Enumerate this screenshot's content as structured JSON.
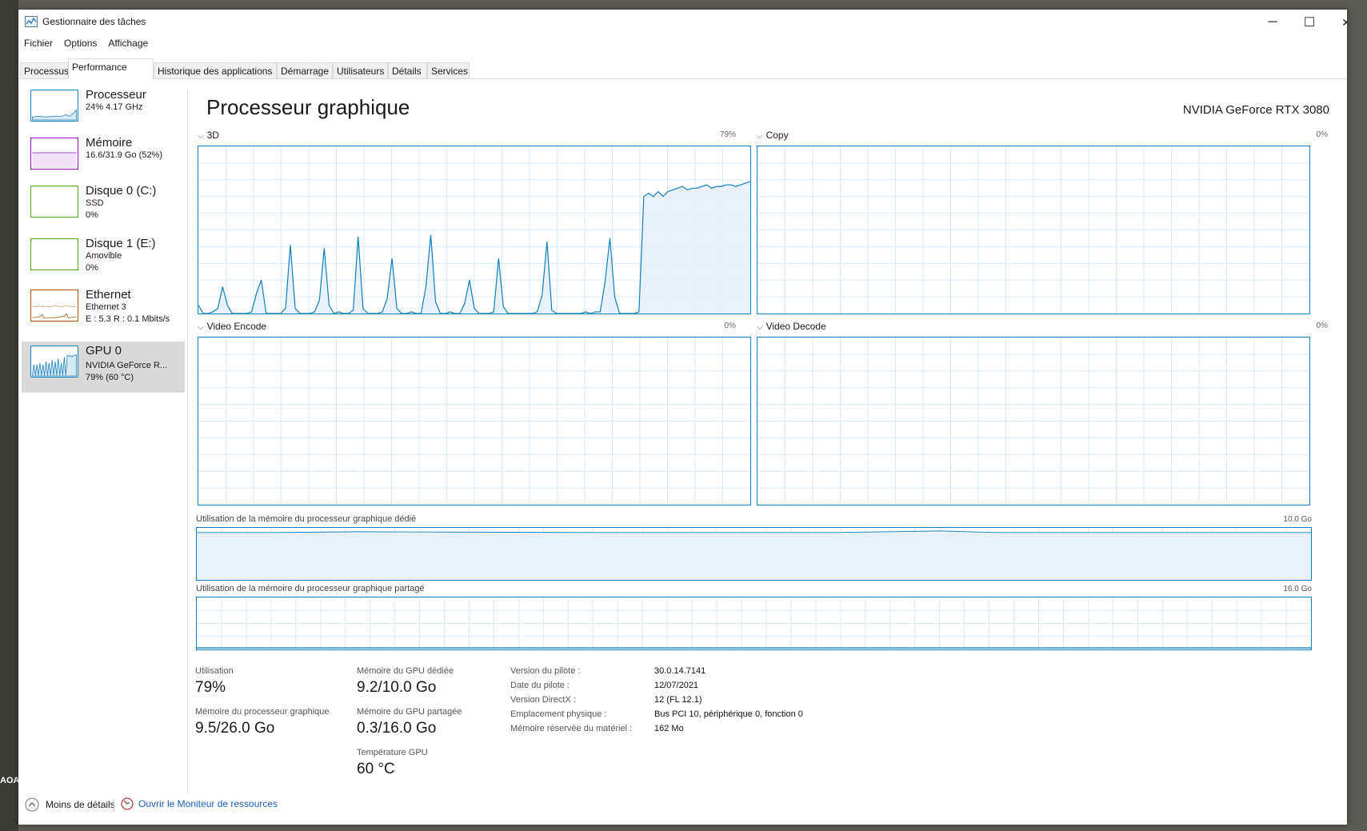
{
  "window": {
    "title": "Gestionnaire des tâches",
    "minimize": "─",
    "maximize": "☐",
    "close": "✕"
  },
  "menu": [
    "Fichier",
    "Options",
    "Affichage"
  ],
  "tabs": [
    "Processus",
    "Performance",
    "Historique des applications",
    "Démarrage",
    "Utilisateurs",
    "Détails",
    "Services"
  ],
  "active_tab": "Performance",
  "sidebar": [
    {
      "name": "Processeur",
      "sub1": "24%  4.17 GHz",
      "sub2": "",
      "color": "#117dbb"
    },
    {
      "name": "Mémoire",
      "sub1": "16.6/31.9 Go (52%)",
      "sub2": "",
      "color": "#8b12ae"
    },
    {
      "name": "Disque 0 (C:)",
      "sub1": "SSD",
      "sub2": "0%",
      "color": "#4da60c"
    },
    {
      "name": "Disque 1 (E:)",
      "sub1": "Amovible",
      "sub2": "0%",
      "color": "#4da60c"
    },
    {
      "name": "Ethernet",
      "sub1": "Ethernet 3",
      "sub2": "E : 5.3  R : 0.1 Mbits/s",
      "color": "#a74f01"
    },
    {
      "name": "GPU 0",
      "sub1": "NVIDIA GeForce R...",
      "sub2": "79%  (60 °C)",
      "color": "#117dbb"
    }
  ],
  "main": {
    "title": "Processeur graphique",
    "gpu_model": "NVIDIA GeForce RTX 3080",
    "engines": [
      {
        "label": "3D",
        "pct": "79%"
      },
      {
        "label": "Copy",
        "pct": "0%"
      },
      {
        "label": "Video Encode",
        "pct": "0%"
      },
      {
        "label": "Video Decode",
        "pct": "0%"
      }
    ],
    "dedicated_label": "Utilisation de la mémoire du processeur graphique dédié",
    "dedicated_max": "10.0 Go",
    "shared_label": "Utilisation de la mémoire du processeur graphique partagé",
    "shared_max": "16.0 Go"
  },
  "stats": {
    "util_label": "Utilisation",
    "util_value": "79%",
    "gpumem_label": "Mémoire du processeur graphique",
    "gpumem_value": "9.5/26.0 Go",
    "dedicated_label": "Mémoire du GPU dédiée",
    "dedicated_value": "9.2/10.0 Go",
    "shared_label": "Mémoire du GPU partagée",
    "shared_value": "0.3/16.0 Go",
    "temp_label": "Température GPU",
    "temp_value": "60 °C"
  },
  "properties": [
    {
      "label": "Version du pilote :",
      "value": "30.0.14.7141"
    },
    {
      "label": "Date du pilote :",
      "value": "12/07/2021"
    },
    {
      "label": "Version DirectX :",
      "value": "12 (FL 12.1)"
    },
    {
      "label": "Emplacement physique :",
      "value": "Bus PCI 10, périphérique 0, fonction 0"
    },
    {
      "label": "Mémoire réservée du matériel :",
      "value": "162 Mo"
    }
  ],
  "footer": {
    "less_details": "Moins de détails",
    "resource_monitor": "Ouvrir le Moniteur de ressources"
  },
  "chart_data": {
    "type": "area",
    "title": "3D",
    "ylim": [
      0,
      100
    ],
    "grid": true,
    "series": [
      {
        "name": "3D",
        "values": [
          5,
          0,
          0,
          1,
          3,
          16,
          5,
          0,
          0,
          0,
          0,
          1,
          12,
          20,
          0,
          0,
          0,
          0,
          3,
          41,
          3,
          0,
          0,
          0,
          1,
          8,
          39,
          5,
          0,
          1,
          0,
          0,
          2,
          46,
          3,
          0,
          0,
          0,
          1,
          9,
          33,
          3,
          0,
          0,
          1,
          0,
          0,
          16,
          47,
          7,
          0,
          0,
          1,
          0,
          0,
          6,
          20,
          3,
          0,
          0,
          0,
          1,
          33,
          4,
          0,
          0,
          0,
          0,
          0,
          0,
          1,
          11,
          43,
          2,
          0,
          0,
          0,
          0,
          0,
          0,
          1,
          0,
          1,
          1,
          19,
          45,
          10,
          0,
          0,
          0,
          0,
          1,
          70,
          72,
          70,
          73,
          70,
          73,
          74,
          75,
          76,
          74,
          75,
          75,
          76,
          77,
          75,
          76,
          76,
          77,
          77,
          76,
          77,
          78,
          79
        ]
      }
    ]
  }
}
